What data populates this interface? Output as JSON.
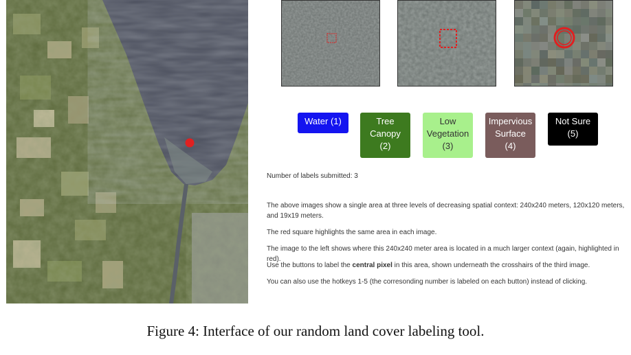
{
  "buttons": [
    {
      "line1": "Water (1)",
      "line2": "",
      "line3": "",
      "bg": "#1414f0",
      "fg": "#ffffff"
    },
    {
      "line1": "Tree",
      "line2": "Canopy",
      "line3": "(2)",
      "bg": "#3d7a1f",
      "fg": "#ffffff"
    },
    {
      "line1": "Low",
      "line2": "Vegetation",
      "line3": "(3)",
      "bg": "#a8f08c",
      "fg": "#333333"
    },
    {
      "line1": "Impervious",
      "line2": "Surface",
      "line3": "(4)",
      "bg": "#7a5c5c",
      "fg": "#ffffff"
    },
    {
      "line1": "Not Sure",
      "line2": "(5)",
      "line3": "",
      "bg": "#000000",
      "fg": "#ffffff"
    }
  ],
  "status": {
    "labels_submitted": "Number of labels submitted: 3"
  },
  "instructions": {
    "p1": "The above images show a single area at three levels of decreasing spatial context: 240x240 meters, 120x120 meters, and 19x19 meters.",
    "p2": "The red square highlights the same area in each image.",
    "p3": "The image to the left shows where this 240x240 meter area is located in a much larger context (again, highlighted in red).",
    "p4_before": "Use the buttons to label the ",
    "p4_bold": "central pixel",
    "p4_after": " in this area, shown underneath the crosshairs of the third image.",
    "p5": "You can also use the hotkeys 1-5 (the corresonding number is labeled on each button) instead of clicking."
  },
  "caption": "Figure 4: Interface of our random land cover labeling tool.",
  "colors": {
    "highlight": "#e02020",
    "water": "#4a4e5c",
    "fields": "#6f7a4a"
  }
}
